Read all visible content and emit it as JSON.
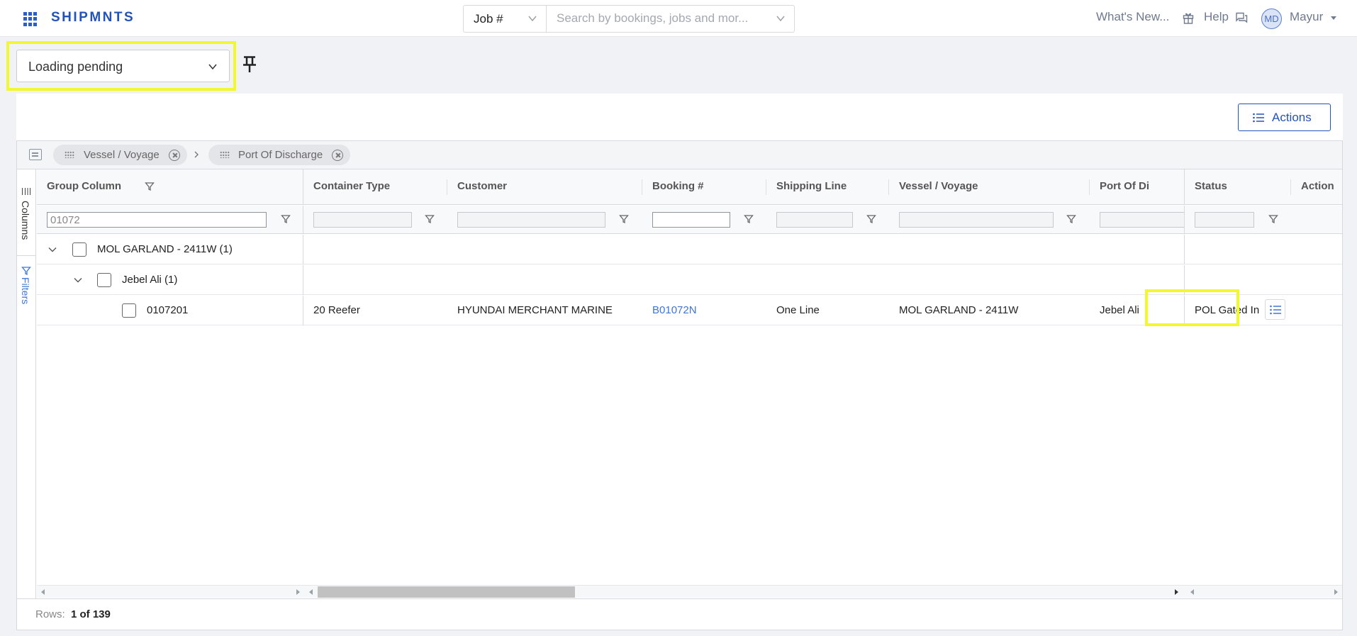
{
  "app": {
    "brand": "SHIPMNTS"
  },
  "header": {
    "search_type": "Job #",
    "search_placeholder": "Search by bookings, jobs and mor...",
    "whats_new": "What's New...",
    "help": "Help",
    "user_initials": "MD",
    "user_name": "Mayur"
  },
  "view": {
    "selected": "Loading pending"
  },
  "toolbar": {
    "actions_label": "Actions"
  },
  "group_chips": [
    "Vessel / Voyage",
    "Port Of Discharge"
  ],
  "side_tabs": {
    "columns": "Columns",
    "filters": "Filters"
  },
  "columns": [
    "Group Column",
    "Container Type",
    "Customer",
    "Booking #",
    "Shipping Line",
    "Vessel / Voyage",
    "Port Of Di",
    "Status",
    "Action"
  ],
  "filters": {
    "group_column": "01072"
  },
  "groups": [
    {
      "label": "MOL GARLAND - 2411W (1)"
    },
    {
      "label": "Jebel Ali (1)"
    }
  ],
  "rows": [
    {
      "container_no": "0107201",
      "container_type": "20 Reefer",
      "customer": "HYUNDAI MERCHANT MARINE",
      "booking": "B01072N",
      "shipping_line": "One Line",
      "vessel_voyage": "MOL GARLAND - 2411W",
      "port_of_discharge": "Jebel Ali",
      "status": "POL Gated In"
    }
  ],
  "footer": {
    "rows_label": "Rows:",
    "rows_value": "1 of 139"
  },
  "colors": {
    "accent": "#2453b8",
    "highlight": "#f3f72d",
    "link": "#3e75d8"
  }
}
